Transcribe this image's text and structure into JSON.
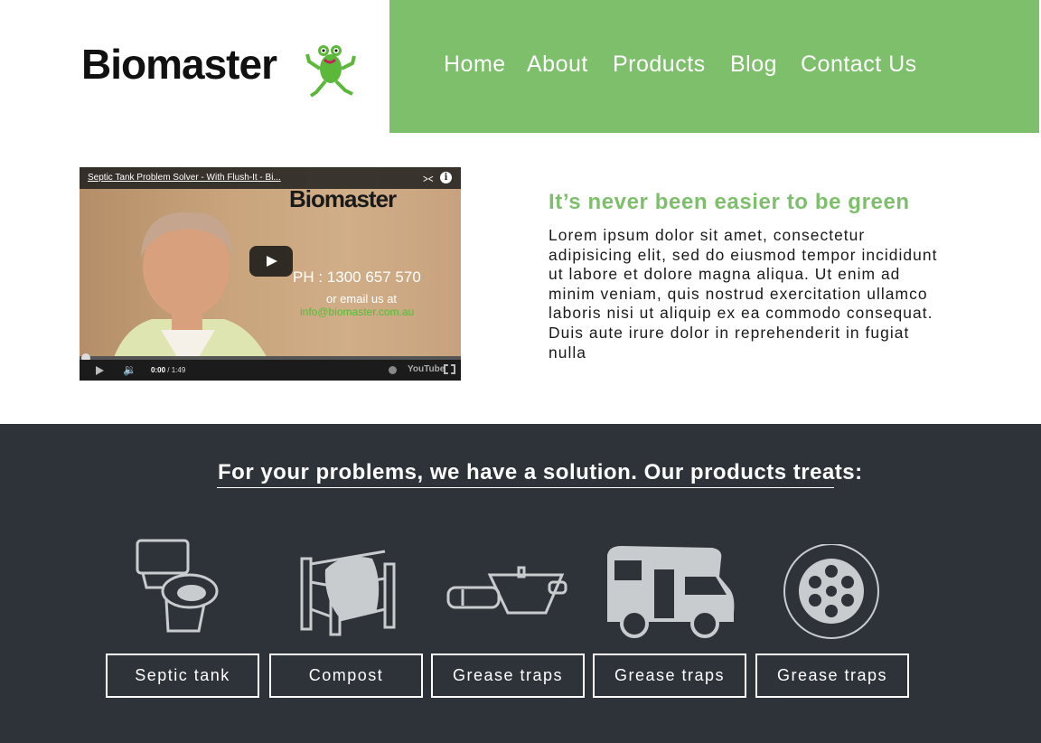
{
  "header": {
    "logo_text": "Biomaster",
    "logo_mascot_icon": "frog-icon",
    "brand_green": "#7dbf6b"
  },
  "nav": {
    "items": [
      {
        "label": "Home"
      },
      {
        "label": "About"
      },
      {
        "label": "Products"
      },
      {
        "label": "Blog"
      },
      {
        "label": "Contact Us"
      }
    ]
  },
  "video": {
    "title": "Septic Tank Problem Solver - With Flush-It - Bi...",
    "logo_text": "Biomaster",
    "phone": "PH : 1300 657 570",
    "email_label": "or email us at",
    "email": "info@biomaster.com.au",
    "time_current": "0:00",
    "time_total": "/ 1:49",
    "progress": 0,
    "provider": "YouTube"
  },
  "intro": {
    "heading": "It’s never been easier to be green",
    "body": "Lorem ipsum dolor sit amet, consectetur adipisicing elit, sed do eiusmod tempor incididunt ut labore et dolore magna aliqua. Ut enim ad minim veniam, quis nostrud exercitation ullamco laboris nisi ut aliquip ex ea commodo consequat. Duis aute irure dolor in reprehenderit in fugiat nulla"
  },
  "products": {
    "heading": "For your problems, we have a solution. Our products treats:",
    "background": "#2d3338",
    "items": [
      {
        "label": "Septic tank",
        "icon": "toilet-icon"
      },
      {
        "label": "Compost",
        "icon": "compost-bin-icon"
      },
      {
        "label": "Grease traps",
        "icon": "grease-trap-icon"
      },
      {
        "label": "Grease traps",
        "icon": "motorhome-icon"
      },
      {
        "label": "Grease traps",
        "icon": "drain-icon"
      }
    ]
  }
}
